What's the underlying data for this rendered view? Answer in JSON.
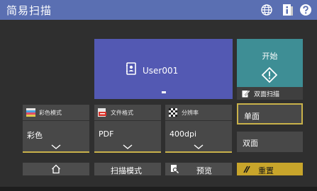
{
  "header": {
    "title": "简易扫描",
    "icons": [
      "globe-icon",
      "info-icon",
      "help-icon"
    ]
  },
  "user_tile": {
    "icon": "address-book-icon",
    "label": "User001"
  },
  "start_button": {
    "label": "开始",
    "icon": "diamond-start-icon"
  },
  "duplex": {
    "title": "双面扫描",
    "icon": "duplex-scan-icon",
    "options": [
      {
        "label": "单面",
        "selected": true
      },
      {
        "label": "双面",
        "selected": false
      }
    ]
  },
  "settings": [
    {
      "title": "彩色模式",
      "value": "彩色",
      "icon": "color-mode-icon"
    },
    {
      "title": "文件格式",
      "value": "PDF",
      "icon": "pdf-file-icon"
    },
    {
      "title": "分辨率",
      "value": "400dpi",
      "icon": "resolution-icon"
    }
  ],
  "bottom_bar": {
    "home_icon": "home-icon",
    "scan_mode_label": "扫描模式",
    "preview_label": "预览",
    "preview_icon": "preview-icon",
    "reset_label": "重置",
    "reset_icon": "reset-icon"
  },
  "colors": {
    "title_bar": "#5a6fb2",
    "user_tile": "#5359b3",
    "start_button": "#3e8e95",
    "accent": "#c9b24a",
    "reset_button": "#c8a52b"
  }
}
